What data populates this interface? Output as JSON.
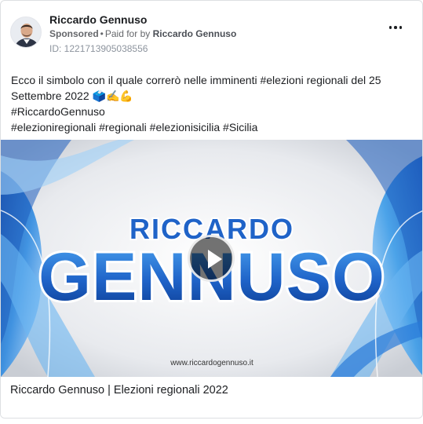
{
  "advertiser": {
    "name": "Riccardo Gennuso",
    "sponsored_label": "Sponsored",
    "paid_for_prefix": "Paid for by",
    "paid_for_name": "Riccardo Gennuso",
    "id_label": "ID: 1221713905038556"
  },
  "post": {
    "line1": "Ecco il simbolo con il quale correrò nelle imminenti #elezioni regionali del 25",
    "line2": "Settembre 2022 🗳️✍️💪",
    "line3": "#RiccardoGennuso",
    "line4": "#elezioniregionali #regionali #elezionisicilia #Sicilia"
  },
  "media": {
    "logo_top": "RICCARDO",
    "logo_bottom": "GENNUSO",
    "website": "www.riccardogennuso.it"
  },
  "link": {
    "title": "Riccardo Gennuso | Elezioni regionali 2022"
  },
  "icons": {
    "more": "more-horizontal-icon",
    "play": "play-icon"
  },
  "colors": {
    "brand_blue": "#1f63c8",
    "text_secondary": "#65676b"
  }
}
